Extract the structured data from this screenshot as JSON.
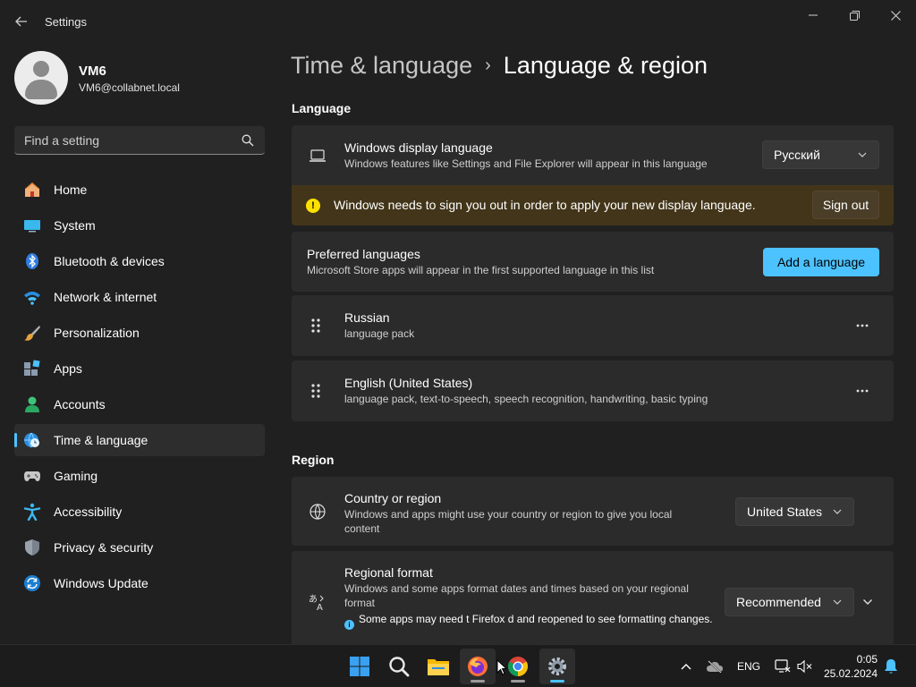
{
  "window": {
    "title": "Settings",
    "back_icon": "back-arrow-icon",
    "controls": [
      "minimize-icon",
      "maximize-icon",
      "close-icon"
    ]
  },
  "profile": {
    "name": "VM6",
    "email": "VM6@collabnet.local"
  },
  "search": {
    "placeholder": "Find a setting"
  },
  "sidebar": {
    "items": [
      {
        "label": "Home",
        "icon": "home-icon"
      },
      {
        "label": "System",
        "icon": "system-icon"
      },
      {
        "label": "Bluetooth & devices",
        "icon": "bluetooth-icon"
      },
      {
        "label": "Network & internet",
        "icon": "wifi-icon"
      },
      {
        "label": "Personalization",
        "icon": "brush-icon"
      },
      {
        "label": "Apps",
        "icon": "apps-icon"
      },
      {
        "label": "Accounts",
        "icon": "accounts-icon"
      },
      {
        "label": "Time & language",
        "icon": "globe-clock-icon",
        "active": true
      },
      {
        "label": "Gaming",
        "icon": "gamepad-icon"
      },
      {
        "label": "Accessibility",
        "icon": "accessibility-icon"
      },
      {
        "label": "Privacy & security",
        "icon": "shield-icon"
      },
      {
        "label": "Windows Update",
        "icon": "update-icon"
      }
    ]
  },
  "breadcrumb": {
    "parent": "Time & language",
    "separator": "›",
    "current": "Language & region"
  },
  "language": {
    "section_title": "Language",
    "display_language": {
      "title": "Windows display language",
      "subtitle": "Windows features like Settings and File Explorer will appear in this language",
      "value": "Русский"
    },
    "warning": {
      "text": "Windows needs to sign you out in order to apply your new display language.",
      "button": "Sign out"
    },
    "preferred": {
      "title": "Preferred languages",
      "subtitle": "Microsoft Store apps will appear in the first supported language in this list",
      "button": "Add a language"
    },
    "languages": [
      {
        "name": "Russian",
        "features": "language pack"
      },
      {
        "name": "English (United States)",
        "features": "language pack, text-to-speech, speech recognition, handwriting, basic typing"
      }
    ]
  },
  "region": {
    "section_title": "Region",
    "country": {
      "title": "Country or region",
      "subtitle": "Windows and apps might use your country or region to give you local content",
      "value": "United States"
    },
    "format": {
      "title": "Regional format",
      "subtitle": "Windows and some apps format dates and times based on your regional format",
      "info": "Some apps may need t   Firefox   d and reopened to see formatting changes.",
      "value": "Recommended"
    }
  },
  "taskbar": {
    "apps": [
      "start-icon",
      "search-icon",
      "file-explorer-icon",
      "firefox-icon",
      "chrome-icon",
      "settings-icon"
    ],
    "tray_language": "ENG",
    "time": "0:05",
    "date": "25.02.2024"
  },
  "colors": {
    "accent": "#4cc2ff",
    "background": "#202020",
    "card": "#2b2b2b",
    "warning_bg": "#433519",
    "warning_icon": "#fce100"
  }
}
